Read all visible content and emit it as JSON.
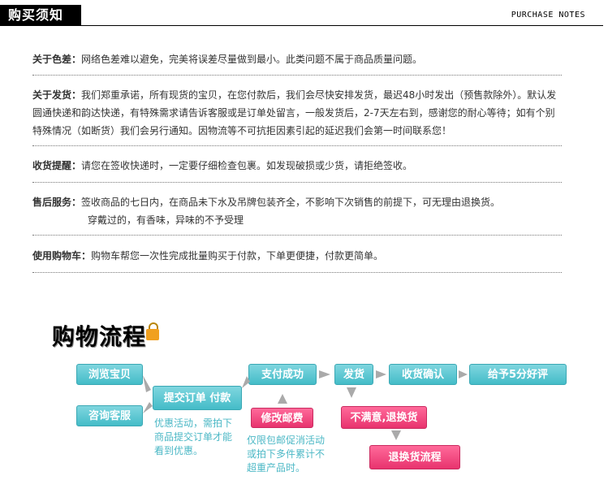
{
  "header": {
    "title": "购买须知",
    "subtitle": "PURCHASE NOTES"
  },
  "notes": [
    {
      "label": "关于色差：",
      "text": "网络色差难以避免，完美将误差尽量做到最小。此类问题不属于商品质量问题。"
    },
    {
      "label": "关于发货：",
      "text": "我们郑重承诺，所有现货的宝贝，在您付款后，我们会尽快安排发货，最迟48小时发出（预售款除外）。默认发圆通快递和韵达快递，有特殊需求请告诉客服或是订单处留言，一般发货后，2-7天左右到，感谢您的耐心等待；如有个别特殊情况（如断货）我们会另行通知。因物流等不可抗拒因素引起的延迟我们会第一时间联系您！"
    },
    {
      "label": "收货提醒：",
      "text": "请您在签收快递时，一定要仔细检查包裹。如发现破损或少货，请拒绝签收。"
    },
    {
      "label": "售后服务：",
      "text": "签收商品的七日内，在商品未下水及吊牌包装齐全，不影响下次销售的前提下，可无理由退换货。",
      "text2": "穿戴过的，有香味，异味的不予受理"
    },
    {
      "label": "使用购物车：",
      "text": "购物车帮您一次性完成批量购买于付款，下单更便捷，付款更简单。"
    }
  ],
  "flow": {
    "title": "购物流程",
    "steps": {
      "browse": "浏览宝贝",
      "consult": "咨询客服",
      "submit": "提交订单 付款",
      "pay": "支付成功",
      "ship": "发货",
      "confirm": "收货确认",
      "rate": "给予5分好评",
      "modify": "修改邮费",
      "unhappy": "不满意,退换货",
      "return_flow": "退换货流程"
    },
    "hints": {
      "discount": "优惠活动，需拍下商品提交订单才能看到优惠。",
      "postage": "仅限包邮促消活动或拍下多件累计不超重产品时。"
    }
  },
  "colors": {
    "accent_blue": "#44bcc8",
    "accent_pink": "#e8336e",
    "hint_text": "#4cb8c6"
  }
}
